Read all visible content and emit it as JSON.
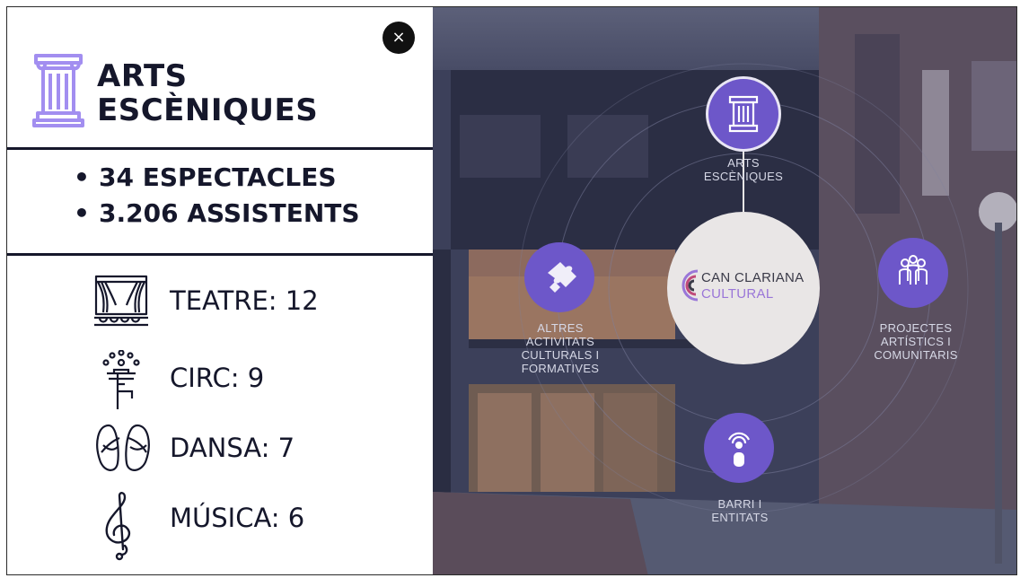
{
  "panel": {
    "close_label": "×",
    "title_line1": "ARTS",
    "title_line2": "ESCÈNIQUES",
    "stats": [
      "34 ESPECTACLES",
      "3.206 ASSISTENTS"
    ],
    "categories": [
      {
        "label": "TEATRE: 12",
        "icon": "theatre-stage-icon"
      },
      {
        "label": "CIRC: 9",
        "icon": "circus-juggler-icon"
      },
      {
        "label": "DANSA: 7",
        "icon": "ballet-shoes-icon"
      },
      {
        "label": "MÚSICA: 6",
        "icon": "treble-clef-icon"
      }
    ]
  },
  "scene": {
    "center": {
      "line1": "CAN CLARIANA",
      "line2": "CULTURAL"
    },
    "nodes": [
      {
        "id": "arts",
        "label_lines": [
          "ARTS",
          "ESCÈNIQUES"
        ],
        "icon": "pillar-icon"
      },
      {
        "id": "altres",
        "label_lines": [
          "ALTRES",
          "ACTIVITATS",
          "CULTURALS I",
          "FORMATIVES"
        ],
        "icon": "puzzle-icon"
      },
      {
        "id": "projectes",
        "label_lines": [
          "PROJECTES",
          "ARTÍSTICS I",
          "COMUNITARIS"
        ],
        "icon": "people-group-icon"
      },
      {
        "id": "barri",
        "label_lines": [
          "BARRI I",
          "ENTITATS"
        ],
        "icon": "person-broadcast-icon"
      }
    ]
  },
  "colors": {
    "accent": "#6d57c9",
    "pillar": "#a28ef0",
    "text_dark": "#15172b",
    "logo_purple": "#9a76d8"
  }
}
